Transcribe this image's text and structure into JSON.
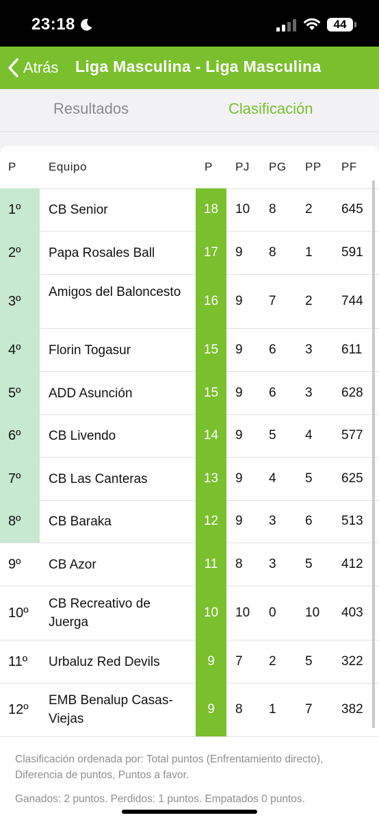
{
  "status_bar": {
    "time": "23:18",
    "battery": "44"
  },
  "nav": {
    "back_label": "Atrás",
    "title": "Liga Masculina - Liga Masculina"
  },
  "tabs": [
    {
      "label": "Resultados"
    },
    {
      "label": "Clasificación"
    }
  ],
  "colors": {
    "accent": "#7abf2d",
    "qualified": "#c8e8d0"
  },
  "table": {
    "headers": [
      "P",
      "Equipo",
      "P",
      "PJ",
      "PG",
      "PP",
      "PF"
    ],
    "rows": [
      {
        "pos": "1º",
        "team": "CB Senior",
        "pts": "18",
        "pj": "10",
        "pg": "8",
        "pp": "2",
        "pf": "645"
      },
      {
        "pos": "2º",
        "team": "Papa Rosales Ball",
        "pts": "17",
        "pj": "9",
        "pg": "8",
        "pp": "1",
        "pf": "591"
      },
      {
        "pos": "3º",
        "team": "Amigos del Baloncesto",
        "pts": "16",
        "pj": "9",
        "pg": "7",
        "pp": "2",
        "pf": "744"
      },
      {
        "pos": "4º",
        "team": "Florin Togasur",
        "pts": "15",
        "pj": "9",
        "pg": "6",
        "pp": "3",
        "pf": "611"
      },
      {
        "pos": "5º",
        "team": "ADD Asunción",
        "pts": "15",
        "pj": "9",
        "pg": "6",
        "pp": "3",
        "pf": "628"
      },
      {
        "pos": "6º",
        "team": "CB Livendo",
        "pts": "14",
        "pj": "9",
        "pg": "5",
        "pp": "4",
        "pf": "577"
      },
      {
        "pos": "7º",
        "team": "CB Las Canteras",
        "pts": "13",
        "pj": "9",
        "pg": "4",
        "pp": "5",
        "pf": "625"
      },
      {
        "pos": "8º",
        "team": "CB Baraka",
        "pts": "12",
        "pj": "9",
        "pg": "3",
        "pp": "6",
        "pf": "513"
      },
      {
        "pos": "9º",
        "team": "CB Azor",
        "pts": "11",
        "pj": "8",
        "pg": "3",
        "pp": "5",
        "pf": "412"
      },
      {
        "pos": "10º",
        "team": "CB Recreativo de Juerga",
        "pts": "10",
        "pj": "10",
        "pg": "0",
        "pp": "10",
        "pf": "403"
      },
      {
        "pos": "11º",
        "team": "Urbaluz Red Devils",
        "pts": "9",
        "pj": "7",
        "pg": "2",
        "pp": "5",
        "pf": "322"
      },
      {
        "pos": "12º",
        "team": "EMB Benalup Casas-Viejas",
        "pts": "9",
        "pj": "8",
        "pg": "1",
        "pp": "7",
        "pf": "382"
      }
    ]
  },
  "footer": {
    "sort_note": "Clasificación ordenada por: Total puntos (Enfrentamiento directo), Diferencia de puntos, Puntos a favor.",
    "points_note": "Ganados: 2 puntos. Perdidos: 1 puntos. Empatados 0 puntos."
  }
}
